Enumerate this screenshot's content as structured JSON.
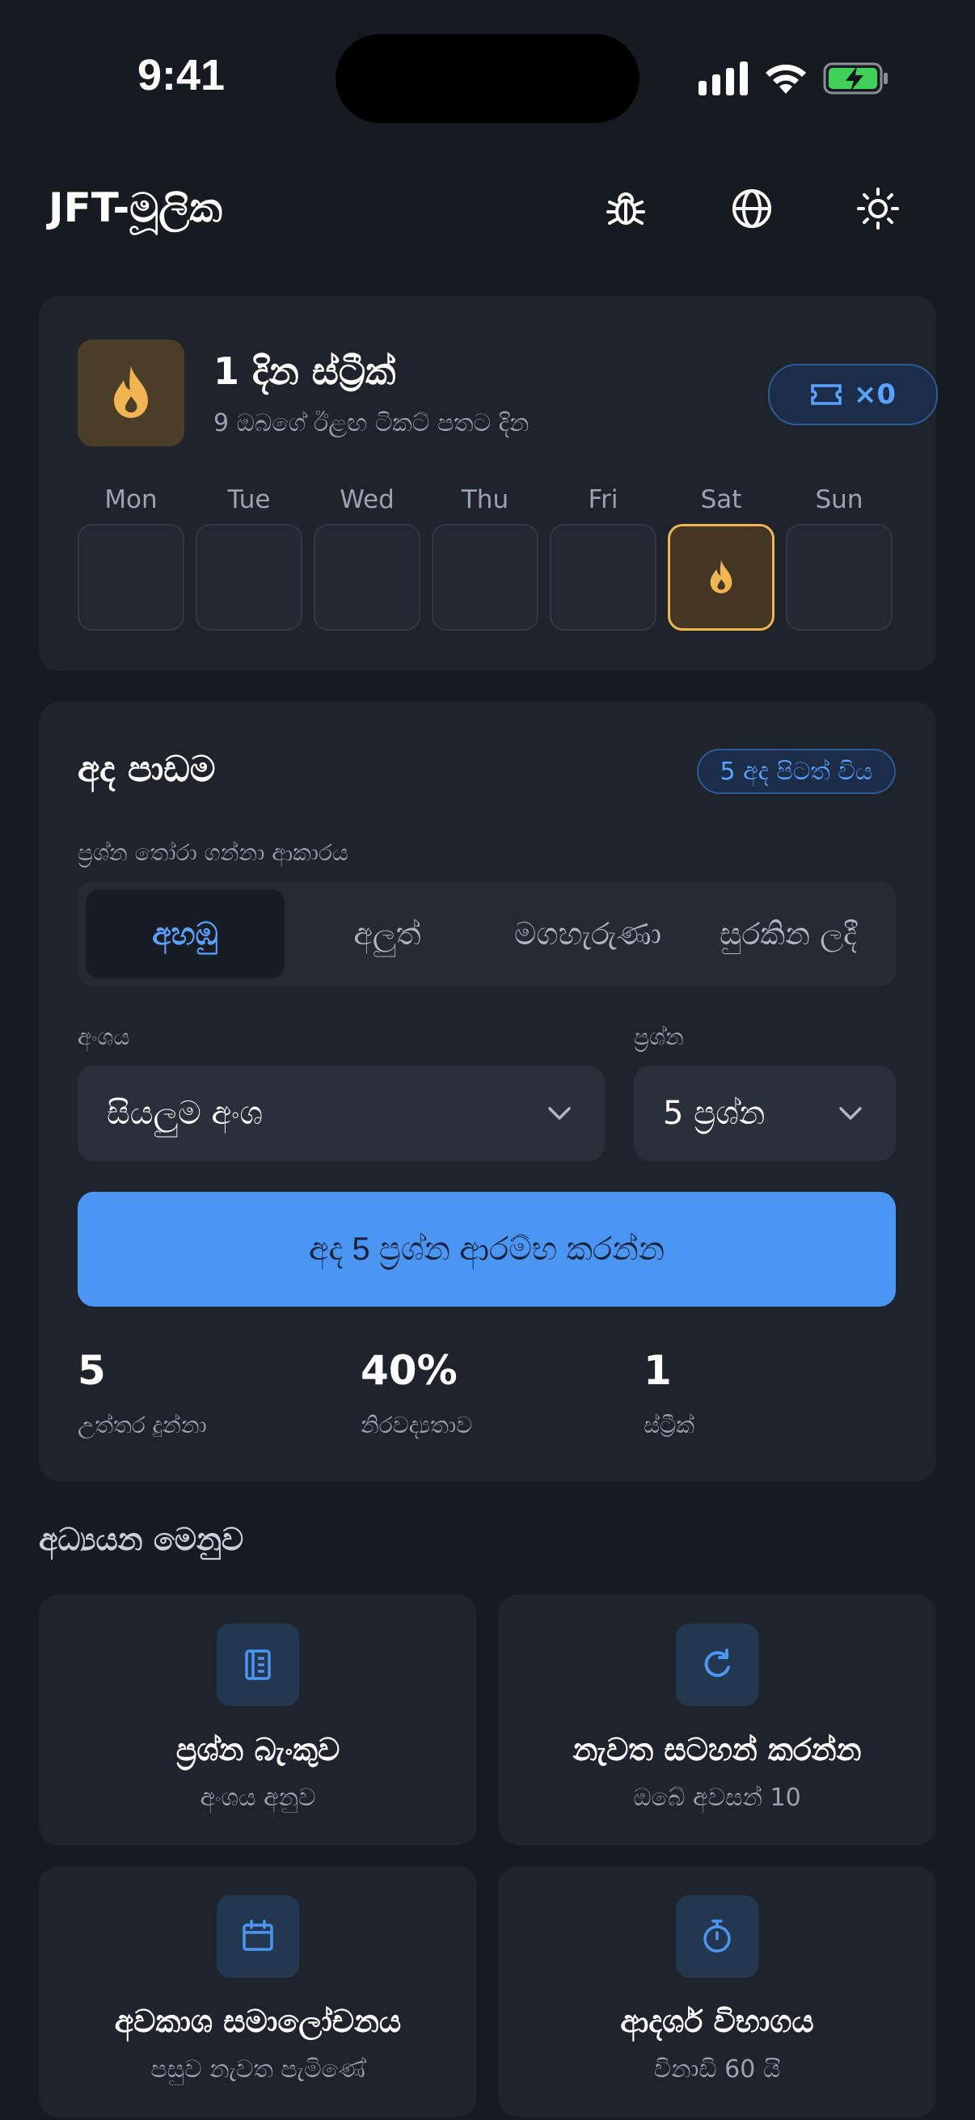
{
  "status": {
    "time": "9:41"
  },
  "header": {
    "title": "JFT-මූලික",
    "icons": [
      "bug-icon",
      "globe-icon",
      "sun-icon"
    ]
  },
  "streak": {
    "title": "1 දින ස්ට්‍රීක්",
    "subtitle": "9 ඔබගේ ඊළඟ ටිකට් පතට දින",
    "tickets": "×0",
    "days": [
      "Mon",
      "Tue",
      "Wed",
      "Thu",
      "Fri",
      "Sat",
      "Sun"
    ],
    "active_day": "Sat"
  },
  "lesson": {
    "title": "අද පාඩම",
    "badge": "5 අද පිටත් විය",
    "mode_label": "ප්‍රශ්න තෝරා ගන්නා ආකාරය",
    "modes": [
      "අහඹු",
      "අලුත්",
      "මගහැරුණා",
      "සුරකින ලදී"
    ],
    "active_mode": "අහඹු",
    "section_label": "අංශය",
    "section_value": "සියලුම අංශ",
    "questions_label": "ප්‍රශ්න",
    "questions_value": "5 ප්‍රශ්න",
    "start_button": "අද 5 ප්‍රශ්න ආරම්භ කරන්න",
    "stats": [
      {
        "value": "5",
        "label": "උත්තර දුන්නා"
      },
      {
        "value": "40%",
        "label": "නිරවද්‍යතාව"
      },
      {
        "value": "1",
        "label": "ස්ට්‍රීක්"
      }
    ]
  },
  "menu": {
    "heading": "අධ්‍යයන මෙනුව",
    "tiles": [
      {
        "title": "ප්‍රශ්න බැංකුව",
        "subtitle": "අංශය අනුව",
        "icon": "book-icon"
      },
      {
        "title": "නැවත සටහන් කරන්න",
        "subtitle": "ඔබේ අවසන් 10",
        "icon": "refresh-icon"
      },
      {
        "title": "අවකාශ සමාලෝචනය",
        "subtitle": "පසුව නැවත පැමිණේ",
        "icon": "calendar-icon"
      },
      {
        "title": "ආදර්ශ විභාගය",
        "subtitle": "විනාඩි 60 යි",
        "icon": "stopwatch-icon"
      }
    ]
  },
  "colors": {
    "accent": "#4a96f2",
    "flame": "#f0b450",
    "background": "#161a21",
    "card": "#1e232c"
  }
}
